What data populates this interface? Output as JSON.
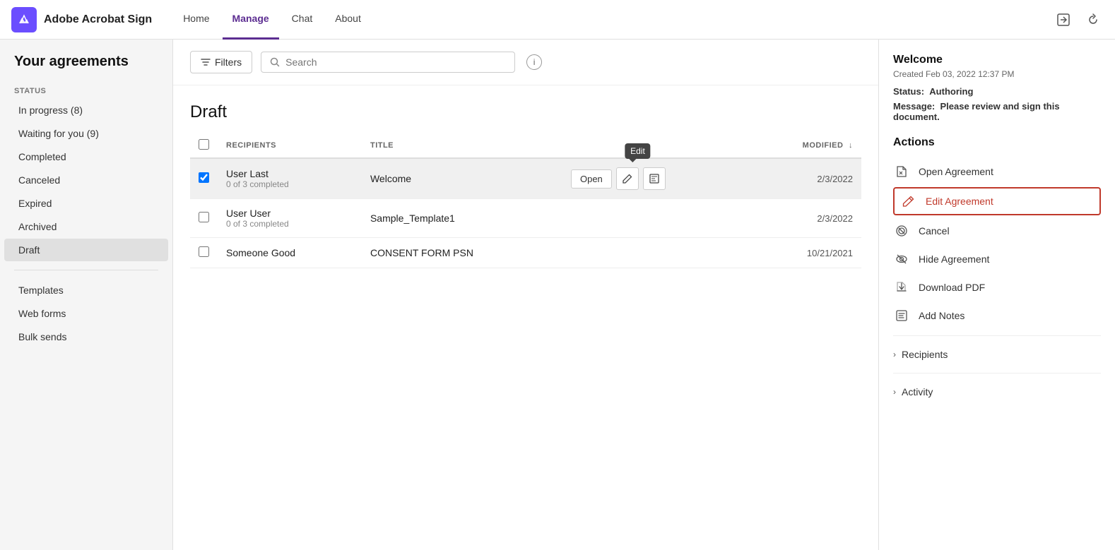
{
  "brand": {
    "logo_text": "A",
    "name": "Adobe Acrobat Sign"
  },
  "topnav": {
    "items": [
      {
        "id": "home",
        "label": "Home",
        "active": false
      },
      {
        "id": "manage",
        "label": "Manage",
        "active": true
      },
      {
        "id": "chat",
        "label": "Chat",
        "active": false
      },
      {
        "id": "about",
        "label": "About",
        "active": false
      }
    ]
  },
  "sidebar": {
    "title": "Your agreements",
    "status_label": "STATUS",
    "items": [
      {
        "id": "in-progress",
        "label": "In progress (8)",
        "active": false
      },
      {
        "id": "waiting-for-you",
        "label": "Waiting for you (9)",
        "active": false
      },
      {
        "id": "completed",
        "label": "Completed",
        "active": false
      },
      {
        "id": "canceled",
        "label": "Canceled",
        "active": false
      },
      {
        "id": "expired",
        "label": "Expired",
        "active": false
      },
      {
        "id": "archived",
        "label": "Archived",
        "active": false
      },
      {
        "id": "draft",
        "label": "Draft",
        "active": true
      }
    ],
    "other_items": [
      {
        "id": "templates",
        "label": "Templates"
      },
      {
        "id": "web-forms",
        "label": "Web forms"
      },
      {
        "id": "bulk-sends",
        "label": "Bulk sends"
      }
    ]
  },
  "header": {
    "filters_label": "Filters",
    "search_placeholder": "Search",
    "filter_icon": "▼",
    "search_icon": "🔍"
  },
  "content": {
    "section_title": "Draft",
    "table": {
      "columns": {
        "checkbox": "",
        "recipients": "RECIPIENTS",
        "title": "TITLE",
        "modified": "MODIFIED"
      },
      "rows": [
        {
          "id": "row1",
          "selected": true,
          "recipient_name": "User Last",
          "recipient_sub": "0 of 3 completed",
          "title": "Welcome",
          "modified": "2/3/2022",
          "show_actions": true
        },
        {
          "id": "row2",
          "selected": false,
          "recipient_name": "User User",
          "recipient_sub": "0 of 3 completed",
          "title": "Sample_Template1",
          "modified": "2/3/2022",
          "show_actions": false
        },
        {
          "id": "row3",
          "selected": false,
          "recipient_name": "Someone Good",
          "recipient_sub": "",
          "title": "CONSENT FORM PSN",
          "modified": "10/21/2021",
          "show_actions": false
        }
      ],
      "open_btn_label": "Open",
      "tooltip_label": "Edit"
    }
  },
  "right_panel": {
    "agreement_title": "Welcome",
    "created_label": "Created Feb 03, 2022 12:37 PM",
    "status_label": "Status:",
    "status_value": "Authoring",
    "message_label": "Message:",
    "message_value": "Please review and sign this document.",
    "actions_title": "Actions",
    "actions": [
      {
        "id": "open-agreement",
        "label": "Open Agreement",
        "icon": "📄",
        "highlighted": false
      },
      {
        "id": "edit-agreement",
        "label": "Edit Agreement",
        "icon": "✏️",
        "highlighted": true
      },
      {
        "id": "cancel",
        "label": "Cancel",
        "icon": "⊗",
        "highlighted": false
      },
      {
        "id": "hide-agreement",
        "label": "Hide Agreement",
        "icon": "🚫",
        "highlighted": false
      },
      {
        "id": "download-pdf",
        "label": "Download PDF",
        "icon": "⬇",
        "highlighted": false
      },
      {
        "id": "add-notes",
        "label": "Add Notes",
        "icon": "📋",
        "highlighted": false
      }
    ],
    "collapsibles": [
      {
        "id": "recipients",
        "label": "Recipients"
      },
      {
        "id": "activity",
        "label": "Activity"
      }
    ]
  }
}
